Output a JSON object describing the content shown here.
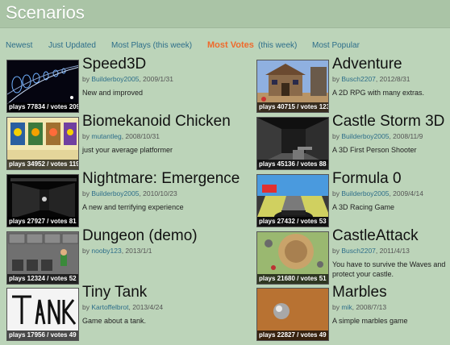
{
  "page": {
    "title": "Scenarios"
  },
  "nav": {
    "newest": "Newest",
    "just_updated": "Just Updated",
    "most_plays": "Most Plays (this week)",
    "most_votes": "Most Votes",
    "most_votes_suffix": "(this week)",
    "most_popular": "Most Popular"
  },
  "scenarios": [
    {
      "name": "Speed3D",
      "by": "by",
      "author": "Builderboy2005",
      "date": ", 2009/1/31",
      "description": "New and improved",
      "stats": "plays 77834 / votes 209"
    },
    {
      "name": "Adventure",
      "by": "by",
      "author": "Busch2207",
      "date": ", 2012/8/31",
      "description": "A 2D RPG with many extras.",
      "stats": "plays 40715 / votes 123"
    },
    {
      "name": "Biomekanoid Chicken",
      "by": "by",
      "author": "mutantleg",
      "date": ", 2008/10/31",
      "description": "just your average platformer",
      "stats": "plays 34952 / votes 119"
    },
    {
      "name": "Castle Storm 3D",
      "by": "by",
      "author": "Builderboy2005",
      "date": ", 2008/11/9",
      "description": "A 3D First Person Shooter",
      "stats": "plays 45136 / votes 88"
    },
    {
      "name": "Nightmare: Emergence",
      "by": "by",
      "author": "Builderboy2005",
      "date": ", 2010/10/23",
      "description": "A new and terrifying experience",
      "stats": "plays 27927 / votes 81"
    },
    {
      "name": "Formula 0",
      "by": "by",
      "author": "Builderboy2005",
      "date": ", 2009/4/14",
      "description": "A 3D Racing Game",
      "stats": "plays 27432 / votes 53"
    },
    {
      "name": "Dungeon (demo)",
      "by": "by",
      "author": "nooby123",
      "date": ", 2013/1/1",
      "description": "",
      "stats": "plays 12324 / votes 52"
    },
    {
      "name": "CastleAttack",
      "by": "by",
      "author": "Busch2207",
      "date": ", 2011/4/13",
      "description": "You have to survive the Waves and protect your castle.",
      "stats": "plays 21680 / votes 51"
    },
    {
      "name": "Tiny Tank",
      "by": "by",
      "author": "Kartoffelbrot",
      "date": ", 2013/4/24",
      "description": "Game about a tank.",
      "stats": "plays 17956 / votes 49"
    },
    {
      "name": "Marbles",
      "by": "by",
      "author": "mik",
      "date": ", 2008/7/13",
      "description": "A simple marbles game",
      "stats": "plays 22827 / votes 49"
    }
  ]
}
